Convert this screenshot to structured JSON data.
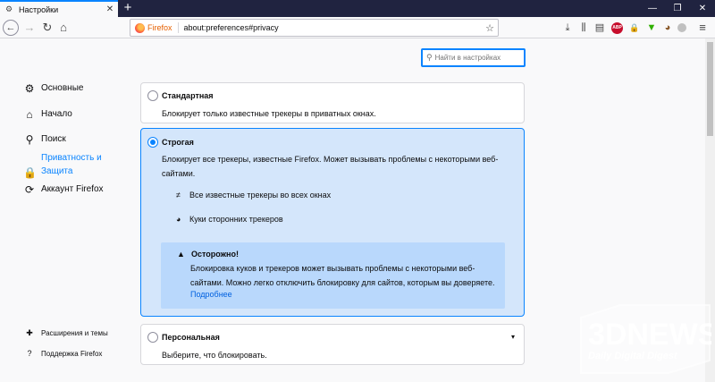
{
  "tab": {
    "title": "Настройки",
    "close": "✕",
    "new_tab": "+"
  },
  "window_controls": {
    "minimize": "—",
    "restore": "❐",
    "close": "✕"
  },
  "nav": {
    "back": "←",
    "forward": "→",
    "reload": "↻",
    "home": "⌂",
    "identity": "Firefox",
    "url": "about:preferences#privacy",
    "star": "☆"
  },
  "toolbar_icons": {
    "downloads": "⤓",
    "library": "⫼",
    "sidebar": "▤",
    "adblock": "ABP",
    "lock": "🔒",
    "green": "▼",
    "cookie": "◕",
    "menu": "≡"
  },
  "search": {
    "placeholder": "Найти в настройках"
  },
  "sidebar": {
    "items": [
      {
        "label": "Основные",
        "icon": "gear-icon"
      },
      {
        "label": "Начало",
        "icon": "home-icon"
      },
      {
        "label": "Поиск",
        "icon": "search-icon"
      },
      {
        "label": "Приватность и Защита",
        "icon": "lock-icon"
      },
      {
        "label": "Аккаунт Firefox",
        "icon": "sync-icon"
      }
    ],
    "footer": [
      {
        "label": "Расширения и темы",
        "icon": "puzzle-icon"
      },
      {
        "label": "Поддержка Firefox",
        "icon": "help-icon"
      }
    ]
  },
  "options": {
    "standard": {
      "title": "Стандартная",
      "desc": "Блокирует только известные трекеры в приватных окнах."
    },
    "strict": {
      "title": "Строгая",
      "desc": "Блокирует все трекеры, известные Firefox. Может вызывать проблемы с некоторыми веб-сайтами.",
      "bullets": [
        "Все известные трекеры во всех окнах",
        "Куки сторонних трекеров"
      ],
      "warning_title": "Осторожно!",
      "warning_body": "Блокировка куков и трекеров может вызывать проблемы с некоторыми веб-сайтами. Можно легко отключить блокировку для сайтов, которым вы доверяете.",
      "warning_link": "Подробнее"
    },
    "custom": {
      "title": "Персональная",
      "desc": "Выберите, что блокировать."
    }
  },
  "watermark": {
    "big": "3DNEWS",
    "small": "Daily Digital Digest"
  }
}
